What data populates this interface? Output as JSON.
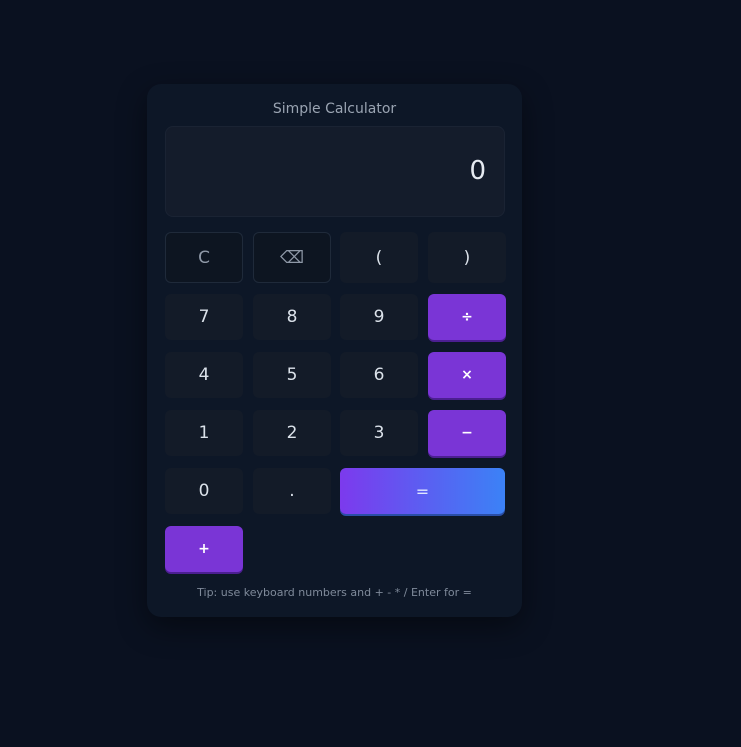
{
  "title": "Simple Calculator",
  "display": {
    "value": "0"
  },
  "keys": {
    "clear": "C",
    "backspace": "⌫",
    "paren_open": "(",
    "paren_close": ")",
    "seven": "7",
    "eight": "8",
    "nine": "9",
    "divide": "÷",
    "four": "4",
    "five": "5",
    "six": "6",
    "multiply": "×",
    "one": "1",
    "two": "2",
    "three": "3",
    "minus": "−",
    "zero": "0",
    "dot": ".",
    "equals": "=",
    "plus": "+"
  },
  "tip": "Tip: use keyboard numbers and + - * / Enter for =",
  "colors": {
    "background": "#0a1120",
    "card": "#0d1727",
    "operator": "#7a35d6",
    "equals_gradient_start": "#7c3aed",
    "equals_gradient_end": "#3b82f6"
  }
}
